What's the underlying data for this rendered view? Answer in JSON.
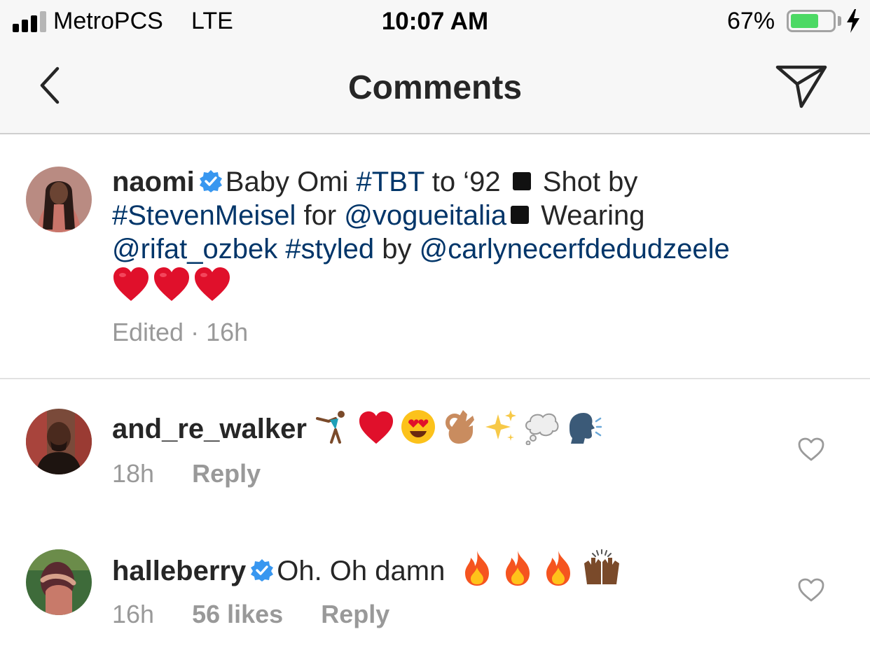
{
  "status_bar": {
    "carrier": "MetroPCS",
    "network": "LTE",
    "time": "10:07 AM",
    "battery_percent": "67%",
    "battery_level": 0.67,
    "signal_bars": 3,
    "signal_total": 4,
    "charging": true
  },
  "nav": {
    "title": "Comments",
    "back_icon": "chevron-left-icon",
    "send_icon": "paper-plane-icon"
  },
  "caption": {
    "username": "naomi",
    "verified": true,
    "parts": {
      "t1": "Baby Omi ",
      "h1": "#TBT",
      "t2": " to ‘92 ",
      "t3": " Shot by ",
      "h2": "#StevenMeisel",
      "t4": " for ",
      "m1": "@vogueitalia",
      "t5": " Wearing ",
      "m2": "@rifat_ozbek",
      "t6": " ",
      "h3": "#styled",
      "t7": " by ",
      "m3": "@carlynecerfdedudzeele"
    },
    "meta": "Edited · 16h"
  },
  "comments": [
    {
      "username": "and_re_walker",
      "verified": false,
      "text": "",
      "emojis": [
        "cartwheel-emoji",
        "red-heart-emoji",
        "heart-eyes-emoji",
        "ok-hand-emoji",
        "sparkles-emoji",
        "thought-balloon-emoji",
        "speaking-head-emoji"
      ],
      "time": "18h",
      "likes": "",
      "reply": "Reply"
    },
    {
      "username": "halleberry",
      "verified": true,
      "text": "Oh. Oh damn",
      "emojis": [
        "fire-emoji",
        "fire-emoji",
        "fire-emoji",
        "raised-hands-emoji"
      ],
      "time": "16h",
      "likes": "56 likes",
      "reply": "Reply"
    }
  ],
  "colors": {
    "hashtag": "#003569",
    "meta_gray": "#999999",
    "verified_blue": "#3897f0",
    "battery_green": "#4cd964",
    "bar_bg": "#f7f7f7"
  }
}
